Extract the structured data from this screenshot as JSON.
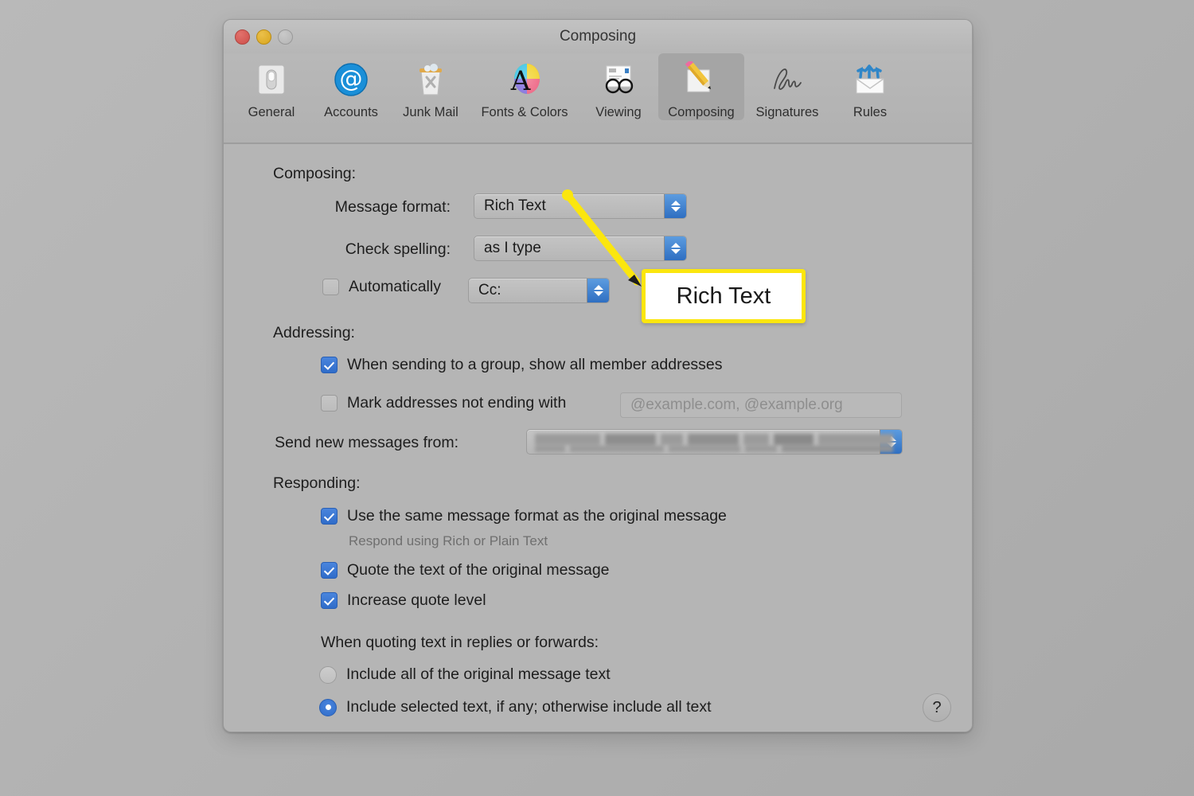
{
  "window": {
    "title": "Composing",
    "traffic_lights": [
      "close-button",
      "minimize-button",
      "zoom-button"
    ]
  },
  "toolbar": {
    "items": [
      {
        "label": "General",
        "icon": "general-switch-icon",
        "selected": false
      },
      {
        "label": "Accounts",
        "icon": "at-sign-icon",
        "selected": false
      },
      {
        "label": "Junk Mail",
        "icon": "trash-can-icon",
        "selected": false
      },
      {
        "label": "Fonts & Colors",
        "icon": "font-color-wheel-icon",
        "selected": false
      },
      {
        "label": "Viewing",
        "icon": "glasses-letter-icon",
        "selected": false
      },
      {
        "label": "Composing",
        "icon": "pencil-paper-icon",
        "selected": true
      },
      {
        "label": "Signatures",
        "icon": "signature-icon",
        "selected": false
      },
      {
        "label": "Rules",
        "icon": "envelope-arrows-icon",
        "selected": false
      }
    ]
  },
  "composing": {
    "heading": "Composing:",
    "message_format": {
      "label": "Message format:",
      "value": "Rich Text"
    },
    "check_spelling": {
      "label": "Check spelling:",
      "value": "as I type"
    },
    "automatically": {
      "label": "Automatically",
      "checked": false,
      "value": "Cc:"
    }
  },
  "addressing": {
    "heading": "Addressing:",
    "group_addresses": {
      "label": "When sending to a group, show all member addresses",
      "checked": true
    },
    "mark_addresses": {
      "label": "Mark addresses not ending with",
      "checked": false,
      "placeholder": "@example.com, @example.org"
    },
    "send_from": {
      "label": "Send new messages from:",
      "value": ""
    }
  },
  "responding": {
    "heading": "Responding:",
    "same_format": {
      "label": "Use the same message format as the original message",
      "sublabel": "Respond using Rich or Plain Text",
      "checked": true
    },
    "quote_text": {
      "label": "Quote the text of the original message",
      "checked": true
    },
    "increase_quote": {
      "label": "Increase quote level",
      "checked": true
    },
    "quoting_heading": "When quoting text in replies or forwards:",
    "radio_all": {
      "label": "Include all of the original message text",
      "selected": false
    },
    "radio_selected": {
      "label": "Include selected text, if any; otherwise include all text",
      "selected": true
    }
  },
  "help": {
    "label": "?"
  },
  "annotation": {
    "callout_text": "Rich Text",
    "highlight_color": "#fbe60e",
    "arrow_color": "#fbe60e"
  },
  "colors": {
    "accent_blue": "#2f6cc9",
    "window_bg": "#b5b5b5",
    "desktop_bg": "#b3b3b3"
  }
}
